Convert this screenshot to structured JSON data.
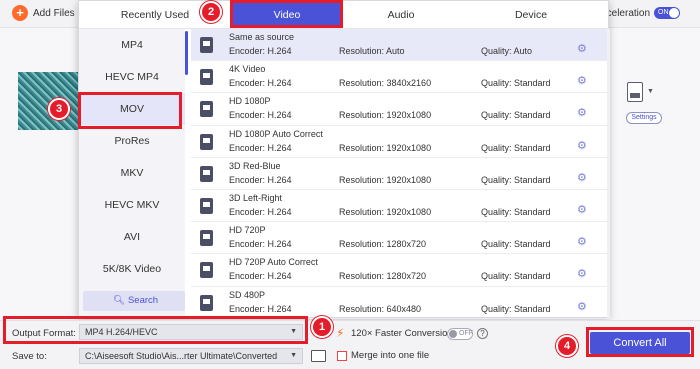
{
  "toolbar": {
    "add_files_label": "Add Files",
    "acceleration_label": "cceleration",
    "acceleration_toggle": "ON"
  },
  "tabs": [
    {
      "label": "Recently Used"
    },
    {
      "label": "Video"
    },
    {
      "label": "Audio"
    },
    {
      "label": "Device"
    }
  ],
  "formats": [
    "MP4",
    "HEVC MP4",
    "MOV",
    "ProRes",
    "MKV",
    "HEVC MKV",
    "AVI",
    "5K/8K Video"
  ],
  "selected_format": "MOV",
  "search_label": "Search",
  "presets": [
    {
      "name": "Same as source",
      "encoder": "Encoder: H.264",
      "resolution": "Resolution: Auto",
      "quality": "Quality: Auto"
    },
    {
      "name": "4K Video",
      "encoder": "Encoder: H.264",
      "resolution": "Resolution: 3840x2160",
      "quality": "Quality: Standard"
    },
    {
      "name": "HD 1080P",
      "encoder": "Encoder: H.264",
      "resolution": "Resolution: 1920x1080",
      "quality": "Quality: Standard"
    },
    {
      "name": "HD 1080P Auto Correct",
      "encoder": "Encoder: H.264",
      "resolution": "Resolution: 1920x1080",
      "quality": "Quality: Standard"
    },
    {
      "name": "3D Red-Blue",
      "encoder": "Encoder: H.264",
      "resolution": "Resolution: 1920x1080",
      "quality": "Quality: Standard"
    },
    {
      "name": "3D Left-Right",
      "encoder": "Encoder: H.264",
      "resolution": "Resolution: 1920x1080",
      "quality": "Quality: Standard"
    },
    {
      "name": "HD 720P",
      "encoder": "Encoder: H.264",
      "resolution": "Resolution: 1280x720",
      "quality": "Quality: Standard"
    },
    {
      "name": "HD 720P Auto Correct",
      "encoder": "Encoder: H.264",
      "resolution": "Resolution: 1280x720",
      "quality": "Quality: Standard"
    },
    {
      "name": "SD 480P",
      "encoder": "Encoder: H.264",
      "resolution": "Resolution: 640x480",
      "quality": "Quality: Standard"
    }
  ],
  "right_panel": {
    "settings_label": "Settings"
  },
  "bottom": {
    "output_format_label": "Output Format:",
    "output_format_value": "MP4 H.264/HEVC",
    "save_to_label": "Save to:",
    "save_to_value": "C:\\Aiseesoft Studio\\Ais...rter Ultimate\\Converted",
    "faster_label": "120× Faster Conversion",
    "faster_toggle": "OFF",
    "merge_label": "Merge into one file",
    "convert_label": "Convert All"
  },
  "badges": [
    "1",
    "2",
    "3",
    "4"
  ],
  "colors": {
    "accent": "#4a52d8",
    "annotation": "#e51d2a",
    "add_icon": "#ff6a2b"
  }
}
